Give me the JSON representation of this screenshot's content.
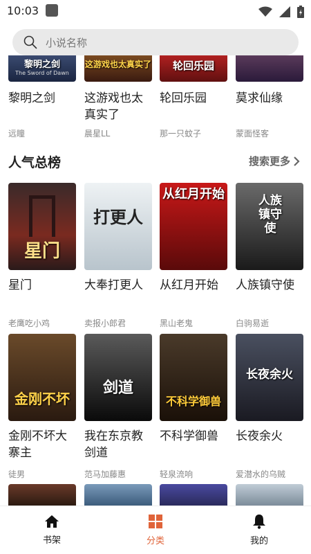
{
  "status": {
    "time": "10:03"
  },
  "search": {
    "placeholder": "小说名称"
  },
  "top_row": [
    {
      "title": "黎明之剑",
      "author": "远瞳",
      "cover_text": "黎明之剑",
      "cover_subtext": "The Sword of Dawn",
      "color": "#2a3550"
    },
    {
      "title": "这游戏也太真实了",
      "author": "晨星LL",
      "cover_text": "这游戏也太真实了",
      "color": "#6a3a1a"
    },
    {
      "title": "轮回乐园",
      "author": "那一只蚊子",
      "cover_text": "轮回乐园",
      "color": "#8b1a1a"
    },
    {
      "title": "莫求仙缘",
      "author": "蒙面怪客",
      "cover_text": "",
      "color": "#3a2a4a"
    }
  ],
  "section": {
    "title": "人气总榜",
    "more": "搜索更多"
  },
  "popular": [
    {
      "title": "星门",
      "author": "老鹰吃小鸡",
      "cover_text": "星门",
      "color": "#5a2a2a"
    },
    {
      "title": "大奉打更人",
      "author": "卖报小郎君",
      "cover_text": "打更人",
      "color": "#cfd8dc"
    },
    {
      "title": "从红月开始",
      "author": "黑山老鬼",
      "cover_text": "从红月开始",
      "color": "#6e1010"
    },
    {
      "title": "人族镇守使",
      "author": "白驹易逝",
      "cover_text": "人族镇守使",
      "color": "#3b3b3b"
    },
    {
      "title": "金刚不坏大寨主",
      "author": "徒男",
      "cover_text": "金刚不坏",
      "color": "#4a3520"
    },
    {
      "title": "我在东京教剑道",
      "author": "范马加藤惠",
      "cover_text": "剑道",
      "color": "#2b2b2b"
    },
    {
      "title": "不科学御兽",
      "author": "轻泉流响",
      "cover_text": "不科学御兽",
      "color": "#3a2a1a"
    },
    {
      "title": "长夜余火",
      "author": "爱潜水的乌贼",
      "cover_text": "长夜余火",
      "color": "#2a3040"
    }
  ],
  "bottom_row_colors": [
    "#4a2a20",
    "#4a6a8a",
    "#3a3a7a",
    "#8a9aa8"
  ],
  "nav": [
    {
      "label": "书架",
      "icon": "home-icon"
    },
    {
      "label": "分类",
      "icon": "grid-icon",
      "active": true
    },
    {
      "label": "我的",
      "icon": "bell-icon"
    }
  ],
  "colors": {
    "accent": "#e0643a"
  }
}
